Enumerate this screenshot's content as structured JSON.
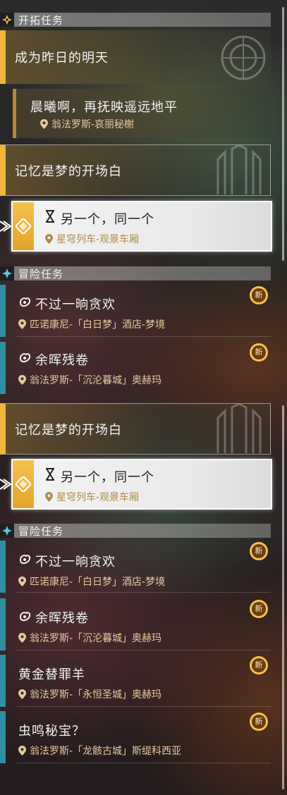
{
  "trailblaze": {
    "header": "开拓任务",
    "card1": {
      "title": "成为昨日的明天",
      "sub_title": "晨曦啊，再抚映遥远地平",
      "sub_location": "翁法罗斯-哀丽秘榭"
    },
    "card2": {
      "title": "记忆是梦的开场白",
      "active_title": "另一个，同一个",
      "active_location": "星穹列车-观景车厢"
    }
  },
  "adventure": {
    "header": "冒险任务",
    "items": [
      {
        "title": "不过一晌贪欢",
        "location": "匹诺康尼-「白日梦」酒店-梦境",
        "badge": "新"
      },
      {
        "title": "余晖残卷",
        "location": "翁法罗斯-「沉沦暮城」奥赫玛",
        "badge": "新"
      }
    ]
  },
  "trailblaze2": {
    "card2": {
      "title": "记忆是梦的开场白",
      "active_title": "另一个，同一个",
      "active_location": "星穹列车-观景车厢"
    }
  },
  "adventure2": {
    "header": "冒险任务",
    "items": [
      {
        "title": "不过一晌贪欢",
        "location": "匹诺康尼-「白日梦」酒店-梦境",
        "badge": "新"
      },
      {
        "title": "余晖残卷",
        "location": "翁法罗斯-「沉沦暮城」奥赫玛",
        "badge": "新"
      },
      {
        "title": "黄金替罪羊",
        "location": "翁法罗斯-「永恒圣城」奥赫玛",
        "badge": "新"
      },
      {
        "title": "虫鸣秘宝？",
        "location": "翁法罗斯-「龙骸古城」斯缇科西亚",
        "badge": "新"
      }
    ]
  },
  "colors": {
    "accent": "#f0b53e",
    "adventure_bar": "#2e8fa0",
    "location_text": "#e6c9a0"
  }
}
